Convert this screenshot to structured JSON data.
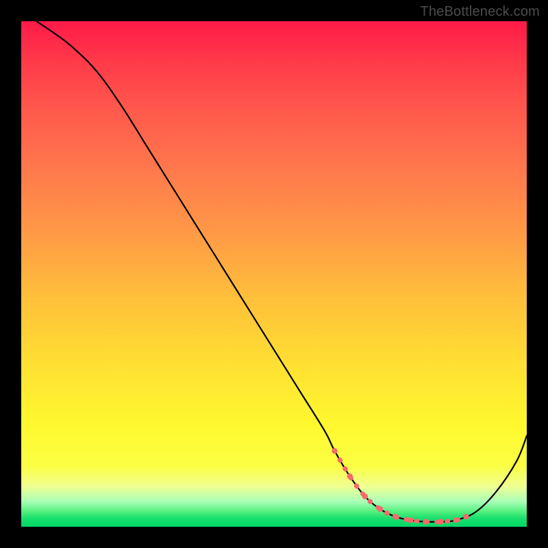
{
  "watermark": "TheBottleneck.com",
  "chart_data": {
    "type": "line",
    "title": "",
    "xlabel": "",
    "ylabel": "",
    "xlim": [
      0,
      100
    ],
    "ylim": [
      0,
      100
    ],
    "curve": {
      "name": "bottleneck-curve",
      "x": [
        3,
        6,
        10,
        15,
        20,
        25,
        30,
        35,
        40,
        45,
        50,
        55,
        60,
        62,
        65,
        68,
        71,
        74,
        77,
        80,
        83,
        86,
        90,
        94,
        98,
        100
      ],
      "y": [
        100,
        98,
        95,
        90,
        83,
        75,
        67,
        59,
        51,
        43,
        35,
        27,
        19,
        15,
        10,
        6,
        3.5,
        2,
        1.3,
        1,
        1,
        1.3,
        3,
        7,
        13,
        18
      ]
    },
    "highlight_band": {
      "name": "optimal-zone",
      "color": "#f46b6b",
      "x": [
        62,
        65,
        68,
        71,
        74,
        77,
        80,
        83,
        86,
        88
      ],
      "y": [
        15,
        10,
        6,
        3.5,
        2,
        1.3,
        1,
        1,
        1.3,
        2
      ]
    },
    "colors": {
      "background_top": "#ff1a48",
      "background_bottom": "#00d765",
      "curve": "#000000",
      "dots": "#f46b6b",
      "frame": "#000000"
    }
  }
}
